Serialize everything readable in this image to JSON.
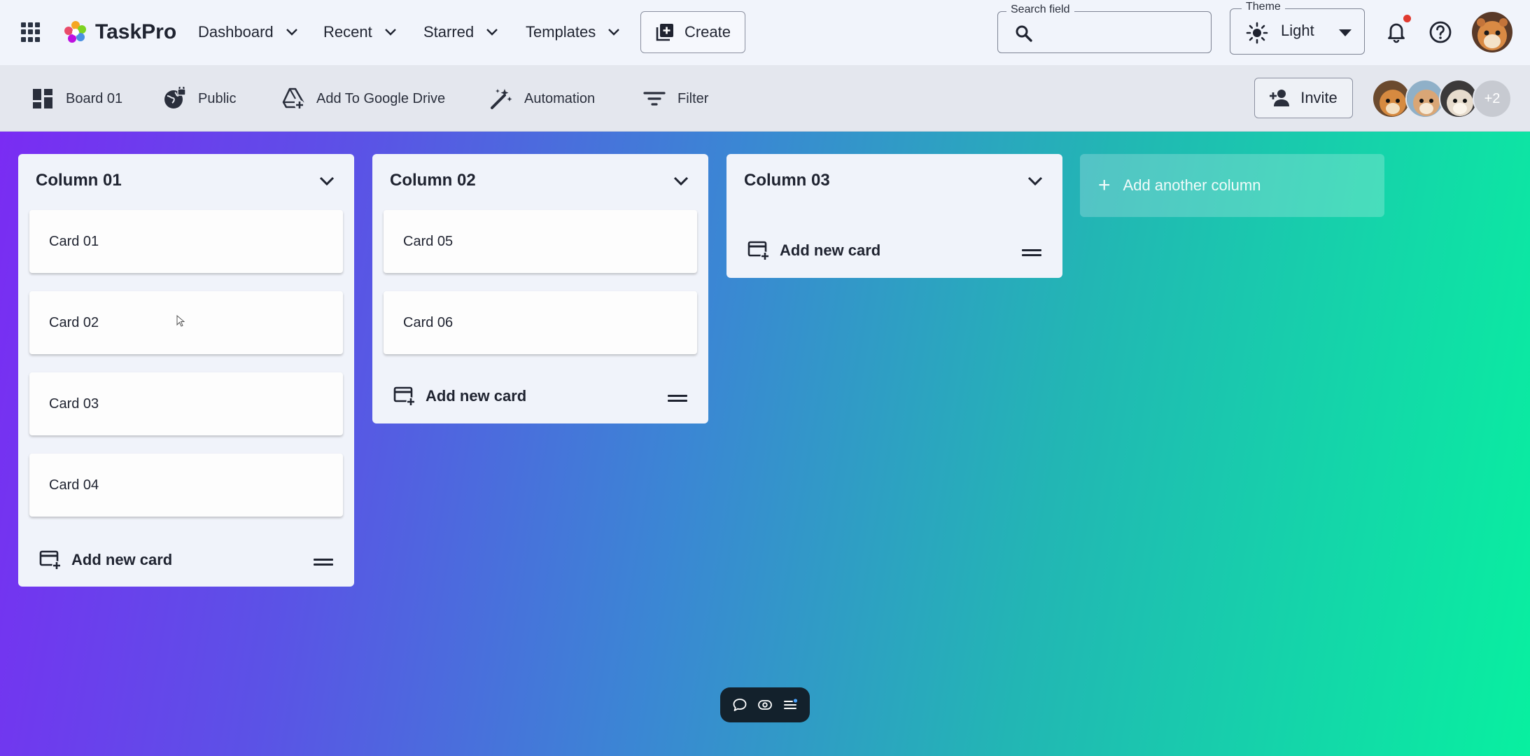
{
  "header": {
    "app_name": "TaskPro",
    "nav": [
      {
        "label": "Dashboard"
      },
      {
        "label": "Recent"
      },
      {
        "label": "Starred"
      },
      {
        "label": "Templates"
      }
    ],
    "create_label": "Create",
    "search": {
      "legend": "Search field",
      "value": "",
      "placeholder": ""
    },
    "theme": {
      "legend": "Theme",
      "value": "Light"
    }
  },
  "board_bar": {
    "board_name": "Board 01",
    "visibility": "Public",
    "drive": "Add To Google Drive",
    "automation": "Automation",
    "filter": "Filter",
    "invite": "Invite",
    "extra_members": "+2"
  },
  "board": {
    "columns": [
      {
        "title": "Column 01",
        "cards": [
          "Card 01",
          "Card 02",
          "Card 03",
          "Card 04"
        ],
        "add_label": "Add new card"
      },
      {
        "title": "Column 02",
        "cards": [
          "Card 05",
          "Card 06"
        ],
        "add_label": "Add new card"
      },
      {
        "title": "Column 03",
        "cards": [],
        "add_label": "Add new card"
      }
    ],
    "add_column_label": "Add another column"
  },
  "colors": {
    "accent_notification": "#e03a2f",
    "gradient_start": "#7a2cf3",
    "gradient_end": "#08f0a0"
  }
}
